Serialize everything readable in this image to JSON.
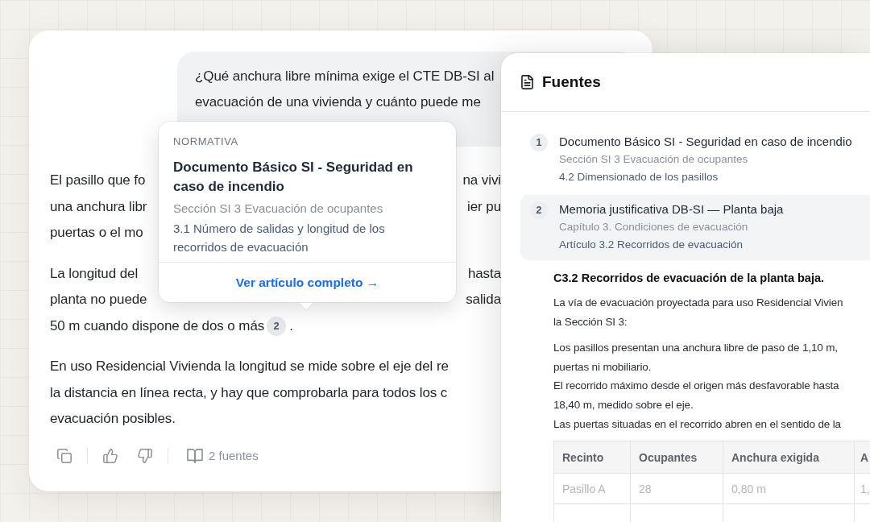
{
  "chat": {
    "question_lines": [
      "¿Qué anchura libre mínima exige el CTE DB-SI al",
      "evacuación de una vivienda y cuánto puede me"
    ],
    "answer_paragraphs": [
      {
        "lines": [
          {
            "parts": [
              {
                "kind": "text",
                "text": "El pasillo que fo"
              }
            ],
            "after_popover": "na vivi"
          },
          {
            "parts": [
              {
                "kind": "text",
                "text": "una anchura libr"
              }
            ],
            "after_popover": "ier pu"
          },
          {
            "parts": [
              {
                "kind": "text",
                "text": "puertas o el mo"
              }
            ]
          }
        ]
      },
      {
        "lines": [
          {
            "parts": [
              {
                "kind": "text",
                "text": "La longitud del"
              }
            ],
            "after_popover": "hasta"
          },
          {
            "parts": [
              {
                "kind": "text",
                "text": "planta no puede"
              }
            ],
            "after_popover": "salida"
          },
          {
            "parts": [
              {
                "kind": "text",
                "text": "50 m cuando dispone de dos o más"
              },
              {
                "kind": "citation",
                "text": "2"
              },
              {
                "kind": "text",
                "text": "."
              }
            ]
          }
        ]
      },
      {
        "lines": [
          {
            "parts": [
              {
                "kind": "text",
                "text": "En uso Residencial Vivienda la longitud se mide sobre el eje del re"
              }
            ]
          },
          {
            "parts": [
              {
                "kind": "text",
                "text": "la distancia en línea recta, y hay que comprobarla para todos los c"
              }
            ]
          },
          {
            "parts": [
              {
                "kind": "text",
                "text": "evacuación posibles."
              }
            ]
          }
        ]
      }
    ],
    "sources_button": "2 fuentes"
  },
  "popover": {
    "category": "NORMATIVA",
    "title": "Documento Básico SI - Seguridad en caso de incendio",
    "section": "Sección SI 3 Evacuación de ocupantes",
    "article": "3.1 Número de salidas y longitud de los recorridos de evacuación",
    "link": "Ver artículo completo →"
  },
  "sources_panel": {
    "title": "Fuentes",
    "sources": [
      {
        "number": "1",
        "title": "Documento Básico SI - Seguridad en caso de incendio",
        "section": "Sección SI 3 Evacuación de ocupantes",
        "article": "4.2 Dimensionado de los pasillos",
        "selected": false
      },
      {
        "number": "2",
        "title": "Memoria justificativa DB-SI — Planta baja",
        "section": "Capítulo 3. Condiciones de evacuación",
        "article": "Artículo 3.2 Recorridos de evacuación",
        "selected": true
      }
    ],
    "document": {
      "heading": "C3.2 Recorridos de evacuación de la planta baja.",
      "paragraphs": [
        [
          "La vía de evacuación proyectada para uso Residencial Vivien",
          "la Sección SI 3:"
        ],
        [
          "Los pasillos presentan una anchura libre de paso de 1,10 m,",
          "puertas ni mobiliario.",
          "El recorrido máximo desde el origen más desfavorable hasta",
          "18,40 m, medido sobre el eje.",
          "Las puertas situadas en el recorrido abren en el sentido de la"
        ]
      ],
      "table": {
        "columns": [
          "Recinto",
          "Ocupantes",
          "Anchura exigida",
          "A"
        ],
        "rows": [
          [
            "Pasillo A",
            "28",
            "0,80 m",
            "1,"
          ]
        ]
      }
    }
  }
}
